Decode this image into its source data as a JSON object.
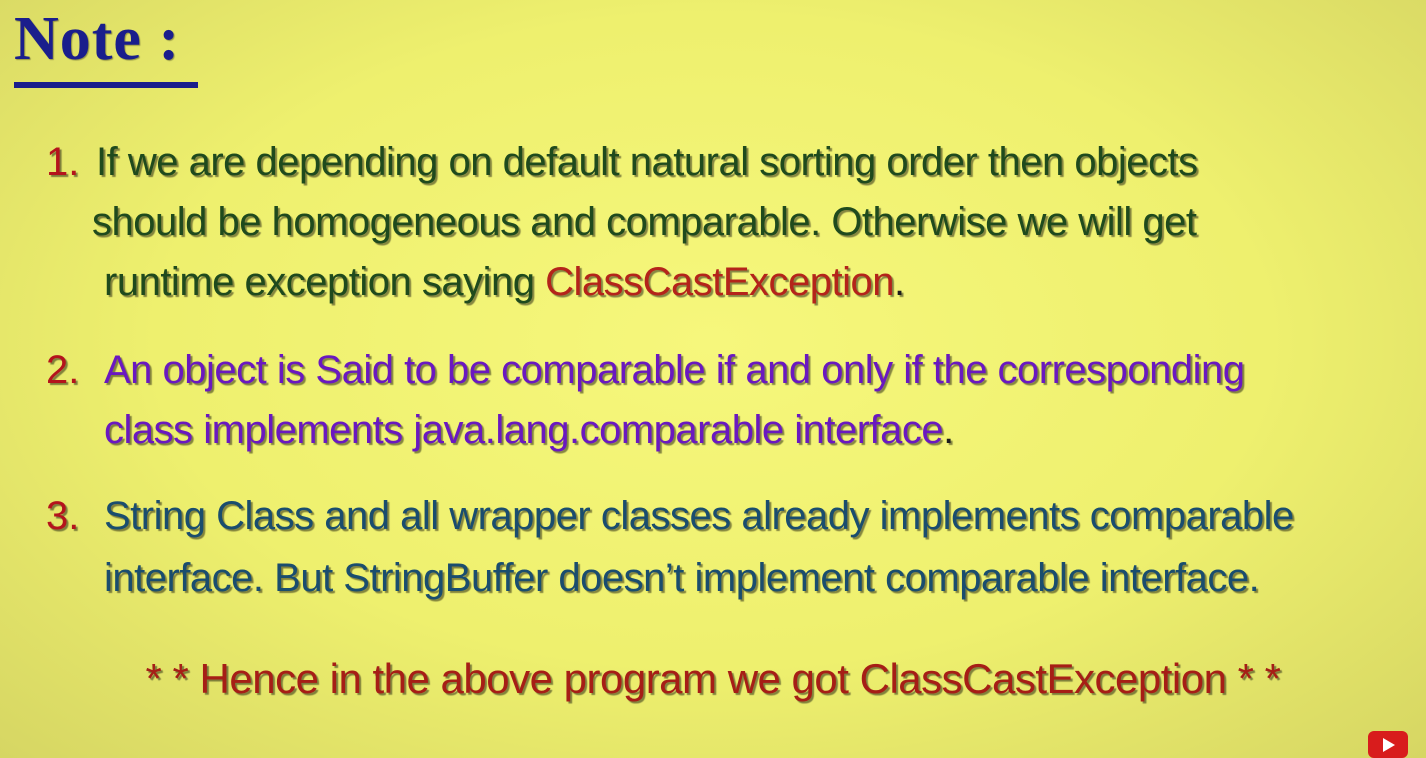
{
  "title": "Note :",
  "points": [
    {
      "number": "1.",
      "line1": "If we are depending on default natural sorting order then objects",
      "line2": "should be homogeneous and comparable. Otherwise we will get",
      "line3_prefix": "runtime exception saying ",
      "line3_highlight": "ClassCastException",
      "line3_suffix": "."
    },
    {
      "number": "2.",
      "line1": "An object is Said to be comparable if and only if the corresponding",
      "line2": "class implements java.lang.comparable interface",
      "line2_suffix": "."
    },
    {
      "number": "3.",
      "line1": "String Class and all wrapper classes already implements comparable",
      "line2": "interface. But StringBuffer doesn’t implement comparable interface."
    }
  ],
  "footer": "* * Hence in the above program we got ClassCastException * *",
  "icons": {
    "play": "youtube-play-icon"
  },
  "colors": {
    "title": "#1a1e8c",
    "number": "#b4141c",
    "point1": "#1f4a1d",
    "point2": "#6a18c0",
    "point3": "#1a4d6e",
    "highlight": "#b4241a"
  }
}
